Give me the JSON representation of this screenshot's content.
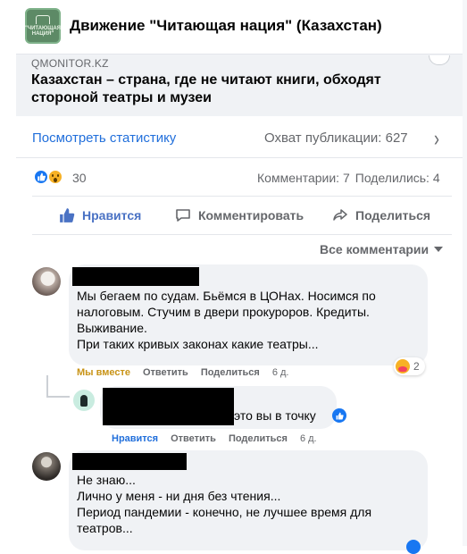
{
  "header": {
    "group_name": "Движение \"Читающая нация\" (Казахстан)",
    "logo_text": "\"ЧИТАЮЩАЯ НАЦИЯ\""
  },
  "link_preview": {
    "domain": "QMONITOR.KZ",
    "title": "Казахстан – страна, где не читают книги, обходят стороной театры и музеи"
  },
  "stats": {
    "view_stats_label": "Посмотреть статистику",
    "reach_label": "Охват публикации: 627"
  },
  "reactions": {
    "icons": [
      "like-reaction",
      "wow-reaction"
    ],
    "count": "30",
    "comments_label": "Комментарии: 7",
    "shares_label": "Поделились: 4"
  },
  "actions": {
    "like": "Нравится",
    "comment": "Комментировать",
    "share": "Поделиться"
  },
  "comment_filter": {
    "label": "Все комментарии"
  },
  "comments": [
    {
      "lines": [
        "Мы бегаем по судам. Бьёмся в ЦОНах. Носимся по",
        "налоговым. Стучим в двери прокуроров. Кредиты.",
        "Выживание.",
        "При таких кривых законах какие театры..."
      ],
      "meta": {
        "reaction": "Мы вместе",
        "reply": "Ответить",
        "share": "Поделиться",
        "time": "6 д."
      },
      "reaction_count": "2",
      "reply": {
        "text": "это вы в точку",
        "meta": {
          "reaction": "Нравится",
          "reply": "Ответить",
          "share": "Поделиться",
          "time": "6 д."
        }
      }
    },
    {
      "lines": [
        "Не знаю...",
        "Лично у меня - ни дня без чтения...",
        "Период пандемии - конечно, не лучшее время для",
        "театров..."
      ]
    }
  ],
  "colors": {
    "link_blue": "#216fdb",
    "like_blue": "#1877f2",
    "secondary_text": "#65676b",
    "care_yellow": "#f7b125",
    "bubble_bg": "#f0f2f5"
  }
}
